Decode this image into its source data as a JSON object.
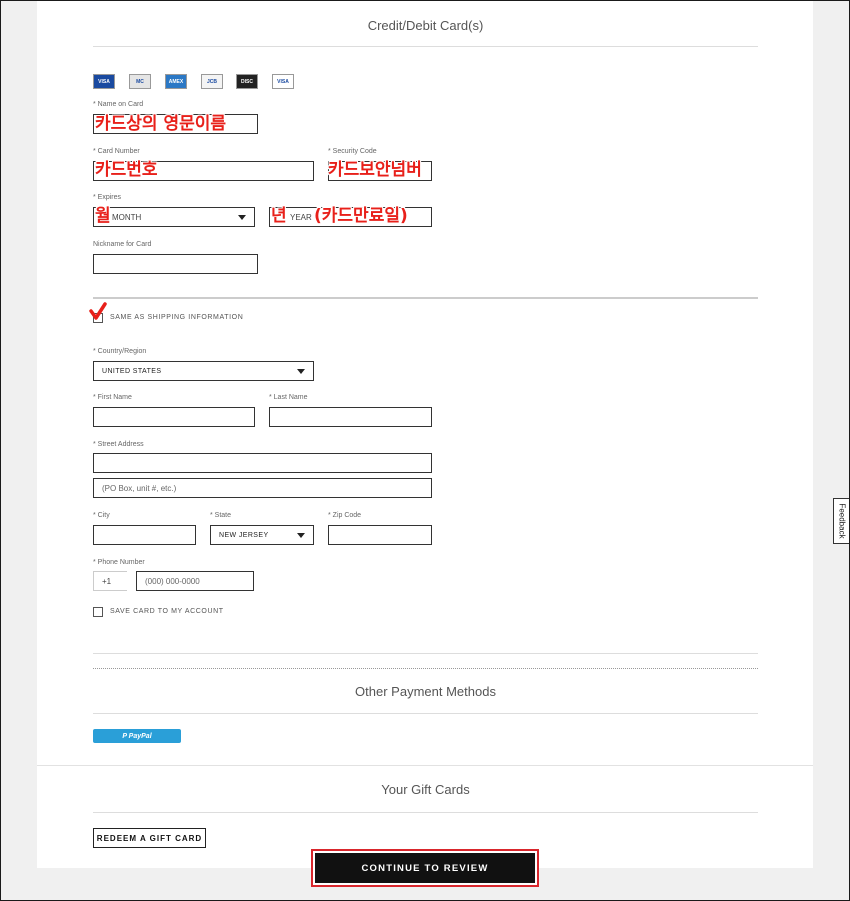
{
  "card_section": {
    "title": "Credit/Debit Card(s)",
    "card_icons": [
      {
        "name": "visa-card-icon",
        "text": "VISA",
        "bg": "#1a4aa0"
      },
      {
        "name": "mastercard-card-icon",
        "text": "MC",
        "bg": "#e5e5e5"
      },
      {
        "name": "amex-card-icon",
        "text": "AMEX",
        "bg": "#2b78c5"
      },
      {
        "name": "jcb-card-icon",
        "text": "JCB",
        "bg": "#f4f4f4"
      },
      {
        "name": "discover-card-icon",
        "text": "DISC",
        "bg": "#222222"
      },
      {
        "name": "visa-debit-card-icon",
        "text": "VISA",
        "bg": "#ffffff"
      }
    ],
    "name_on_card_label": "* Name on Card",
    "card_number_label": "* Card Number",
    "security_code_label": "* Security Code",
    "expires_label": "* Expires",
    "expires_month_value": "MONTH",
    "expires_year_value": "YEAR",
    "nickname_label": "Nickname for Card",
    "annotations": {
      "name_on_card": "카드상의 영문이름",
      "card_number": "카드번호",
      "security_code": "카드보안넘버",
      "month": "월",
      "year": "년",
      "year_note": "(카드만료일)"
    }
  },
  "billing": {
    "same_as_shipping_label": "SAME AS SHIPPING INFORMATION",
    "country_label": "* Country/Region",
    "country_value": "UNITED STATES",
    "first_name_label": "* First Name",
    "last_name_label": "* Last Name",
    "street_label": "* Street Address",
    "street2_placeholder": "(PO Box, unit #, etc.)",
    "city_label": "* City",
    "state_label": "* State",
    "state_value": "NEW JERSEY",
    "zip_label": "* Zip Code",
    "phone_label": "* Phone Number",
    "phone_prefix": "+1",
    "phone_placeholder": "(000) 000-0000",
    "save_card_label": "SAVE CARD TO MY ACCOUNT"
  },
  "other_payment": {
    "title": "Other Payment Methods",
    "paypal_label": "P PayPal"
  },
  "gift_cards": {
    "title": "Your Gift Cards",
    "redeem_label": "REDEEM A GIFT CARD"
  },
  "continue_label": "CONTINUE TO REVIEW",
  "feedback_label": "Feedback",
  "colors": {
    "accent_red": "#e8201a",
    "paypal_blue": "#2a9fd8",
    "button_black": "#111111"
  }
}
